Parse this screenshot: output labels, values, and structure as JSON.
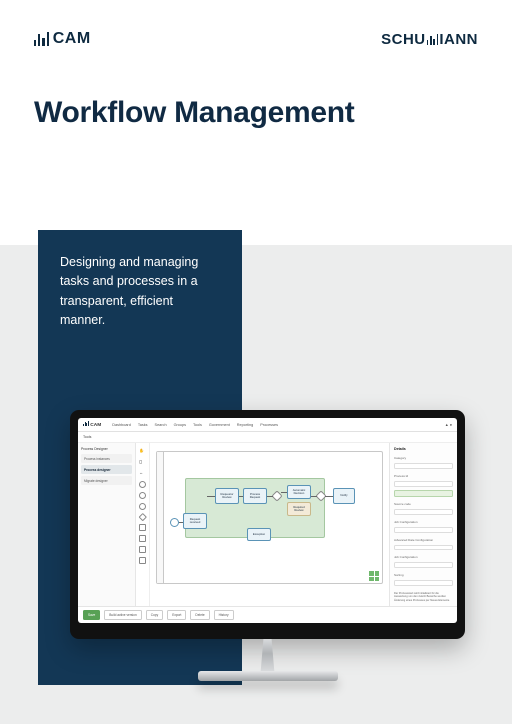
{
  "header": {
    "product_name": "CAM",
    "company_name_pre": "SCHU",
    "company_name_post": "IANN"
  },
  "page": {
    "title": "Workflow Management",
    "tagline": "Designing and managing tasks and processes in a transparent, efficient manner."
  },
  "app_screenshot": {
    "logo": "CAM",
    "nav": {
      "dashboard": "Dashboard",
      "tasks": "Tasks",
      "search": "Search",
      "groups": "Groups",
      "tools": "Tools",
      "government": "Government",
      "reporting": "Reporting",
      "processes": "Processes"
    },
    "subheader": "Tools",
    "sidebar_title": "Process Designer",
    "sidebar": {
      "item1": "Process instances",
      "item2": "Process designer",
      "item3": "Migrate designer"
    },
    "nodes": {
      "n1": "Request received",
      "n2": "Requestor Review",
      "n3": "Process Request",
      "n4": "Automatic Decision",
      "n4b": "Required Review",
      "n5": "Notify",
      "bottom": "Exception"
    },
    "bottom_toolbar": {
      "save": "Save",
      "new_version": "Build active version",
      "copy": "Copy",
      "export": "Export",
      "delete": "Delete",
      "history": "History"
    },
    "right_panel": {
      "title": "Details",
      "label_category": "Category",
      "label_id": "Process Id",
      "label_code": "Source code",
      "label_storage": "Job Configuration",
      "label_storage2": "Advanced Date Configuration",
      "label_job": "Job Configuration",
      "label_sort": "Sorting",
      "desc": "Der Prozessstart wird initialisiert für die Auswertung von den zuletzt Bereiche werden Änderung eines Prozesses per Neues Elemente"
    }
  }
}
